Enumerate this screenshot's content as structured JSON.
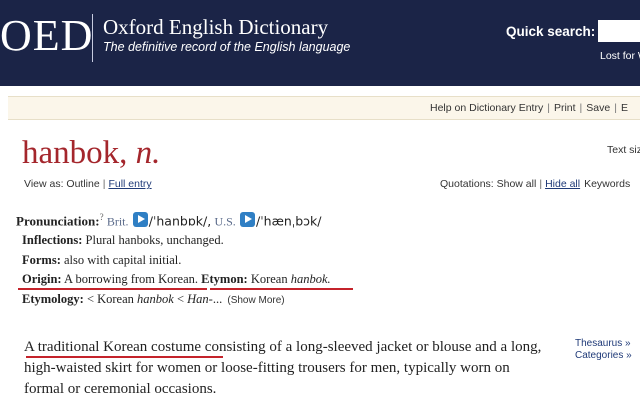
{
  "header": {
    "logo": "OED",
    "title": "Oxford English Dictionary",
    "tagline": "The definitive record of the English language",
    "quick_search_label": "Quick search:",
    "quick_search_value": "",
    "lost_for_words": "Lost for W"
  },
  "util_bar": {
    "help": "Help on Dictionary Entry",
    "print": "Print",
    "save": "Save",
    "more": "E",
    "separator": "|"
  },
  "entry": {
    "headword": "hanbok,",
    "pos": "n.",
    "text_size": "Text siz",
    "view_as_label": "View as:",
    "view_outline": "Outline",
    "view_full": "Full entry",
    "quotations_label": "Quotations:",
    "show_all": "Show all",
    "hide_all": "Hide all",
    "keywords": "Keywords"
  },
  "pronunciation": {
    "label": "Pronunciation:",
    "help_marker": "?",
    "brit_label": "Brit.",
    "brit_ipa": "/ˈhanbɒk/,",
    "us_label": "U.S.",
    "us_ipa": "/ˈhænˌbɔk/"
  },
  "inflections": {
    "label": "Inflections:",
    "text": "Plural hanboks, unchanged."
  },
  "forms": {
    "label": "Forms:",
    "text": "also with capital initial."
  },
  "origin": {
    "label": "Origin:",
    "text": "A borrowing from Korean."
  },
  "etymon": {
    "label": "Etymon:",
    "text": "Korean",
    "word": "hanbok."
  },
  "etymology": {
    "label": "Etymology:",
    "text_prefix": "< Korean",
    "word": "hanbok",
    "text_mid": "<",
    "han": "Han-",
    "ellipsis": "...",
    "show_more": "(Show More)"
  },
  "definition": {
    "highlight": "A traditional Korean costume",
    "rest": "consisting of a long-sleeved jacket or blouse and a long, high-waisted skirt for women or loose-fitting trousers for men, typically worn on formal or ceremonial occasions."
  },
  "side_links": {
    "thesaurus": "Thesaurus »",
    "categories": "Categories »"
  },
  "colors": {
    "header_bg": "#1b2447",
    "headword": "#a4262c",
    "underline": "#c4232b",
    "util_bg": "#fbf6ea",
    "audio": "#2f7fc4"
  }
}
